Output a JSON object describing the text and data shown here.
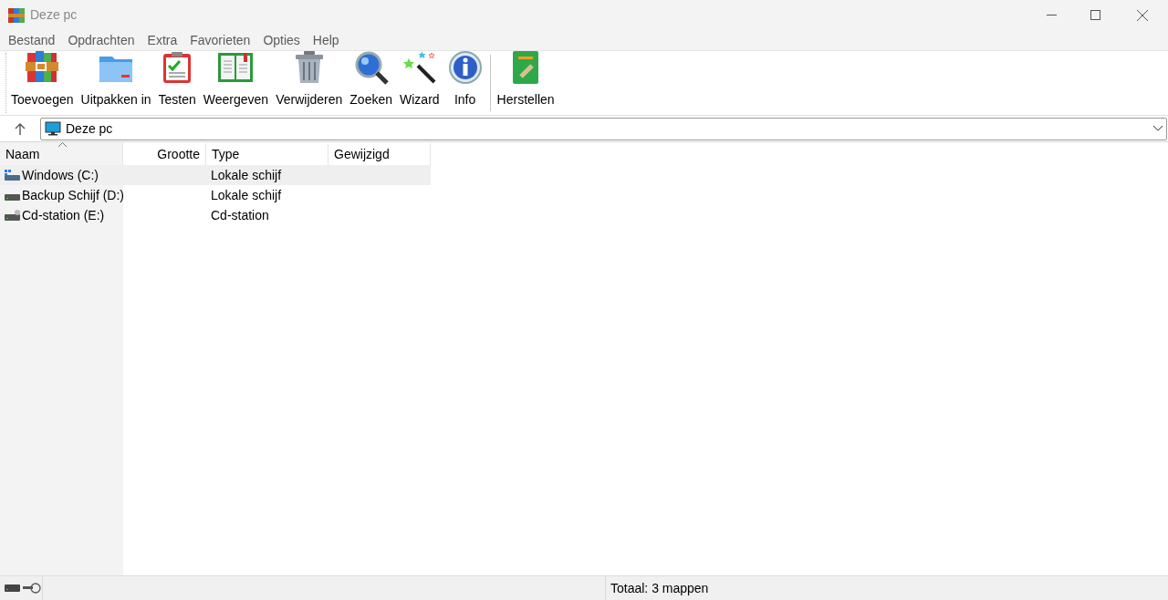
{
  "window": {
    "title": "Deze pc"
  },
  "menu": [
    "Bestand",
    "Opdrachten",
    "Extra",
    "Favorieten",
    "Opties",
    "Help"
  ],
  "toolbar": {
    "buttons": [
      {
        "label": "Toevoegen",
        "kind": "archive"
      },
      {
        "label": "Uitpakken in",
        "kind": "folder"
      },
      {
        "label": "Testen",
        "kind": "clipboard"
      },
      {
        "label": "Weergeven",
        "kind": "book"
      },
      {
        "label": "Verwijderen",
        "kind": "trash"
      },
      {
        "label": "Zoeken",
        "kind": "magnifier"
      },
      {
        "label": "Wizard",
        "kind": "wand"
      },
      {
        "label": "Info",
        "kind": "info"
      }
    ],
    "extra_buttons": [
      {
        "label": "Herstellen",
        "kind": "repair"
      }
    ]
  },
  "address": {
    "value": "Deze pc"
  },
  "table": {
    "columns": [
      {
        "label": "Naam",
        "sorted": true
      },
      {
        "label": "Grootte",
        "sorted": false
      },
      {
        "label": "Type",
        "sorted": false
      },
      {
        "label": "Gewijzigd",
        "sorted": false
      }
    ],
    "rows": [
      {
        "name": "Windows (C:)",
        "type": "Lokale schijf",
        "kind": "system",
        "selected": true
      },
      {
        "name": "Backup Schijf (D:)",
        "type": "Lokale schijf",
        "kind": "disk",
        "selected": false
      },
      {
        "name": "Cd-station (E:)",
        "type": "Cd-station",
        "kind": "cd",
        "selected": false
      }
    ]
  },
  "status_bar": {
    "text": "Totaal: 3 mappen"
  }
}
